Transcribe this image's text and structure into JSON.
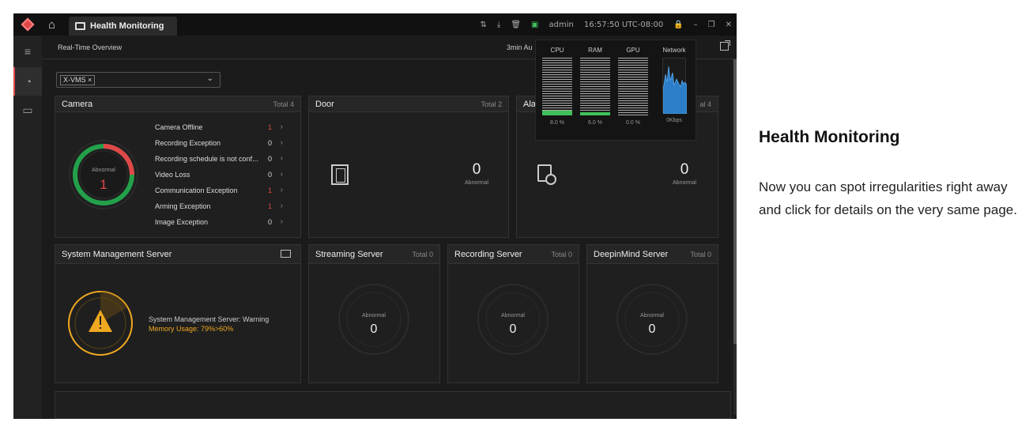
{
  "titlebar": {
    "tab_label": "Health Monitoring",
    "user": "admin",
    "time": "16:57:50 UTC-08:00"
  },
  "subheader": {
    "title": "Real-Time Overview",
    "refresh": "3min Au"
  },
  "filter": {
    "chip": "X-VMS ×"
  },
  "camera": {
    "title": "Camera",
    "total": "Total 4",
    "ring_label": "Abnormal",
    "ring_value": "1",
    "abnormal_fraction": 0.25,
    "items": [
      {
        "label": "Camera Offline",
        "count": "1",
        "red": true
      },
      {
        "label": "Recording Exception",
        "count": "0",
        "red": false
      },
      {
        "label": "Recording schedule is not conf...",
        "count": "0",
        "red": false
      },
      {
        "label": "Video Loss",
        "count": "0",
        "red": false
      },
      {
        "label": "Communication Exception",
        "count": "1",
        "red": true
      },
      {
        "label": "Arming Exception",
        "count": "1",
        "red": true
      },
      {
        "label": "Image Exception",
        "count": "0",
        "red": false
      }
    ]
  },
  "door": {
    "title": "Door",
    "total": "Total 2",
    "value": "0",
    "label": "Abnormal"
  },
  "alarm": {
    "title": "Ala",
    "total": "al 4",
    "value": "0",
    "label": "Abnormal"
  },
  "sms": {
    "title": "System Management Server",
    "status": "System Management Server: Warning",
    "detail": "Memory Usage: 79%>60%"
  },
  "servers": [
    {
      "title": "Streaming Server",
      "total": "Total 0",
      "label": "Abnormal",
      "value": "0"
    },
    {
      "title": "Recording Server",
      "total": "Total 0",
      "label": "Abnormal",
      "value": "0"
    },
    {
      "title": "DeepinMind Server",
      "total": "Total 0",
      "label": "Abnormal",
      "value": "0"
    }
  ],
  "resources": [
    {
      "label": "CPU",
      "value": "8.0 %",
      "level": 0.08
    },
    {
      "label": "RAM",
      "value": "6.0 %",
      "level": 0.06
    },
    {
      "label": "GPU",
      "value": "0.0 %",
      "level": 0.0
    },
    {
      "label": "Network",
      "value": "0Kbps"
    }
  ],
  "colors": {
    "red": "#e04848",
    "green": "#23a04a",
    "warning": "#f0a820",
    "network": "#2d7ec8"
  },
  "caption": {
    "title": "Health Monitoring",
    "body": "Now you can spot irregularities right away and click for details on the very same page."
  }
}
